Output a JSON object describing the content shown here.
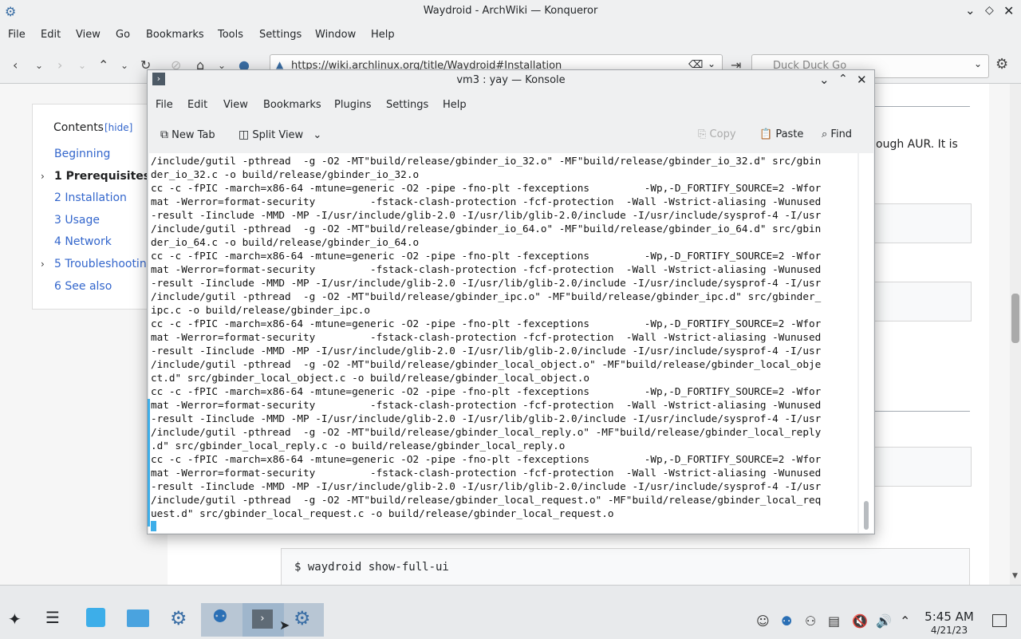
{
  "konqueror": {
    "title": "Waydroid - ArchWiki — Konqueror",
    "menu": [
      "File",
      "Edit",
      "View",
      "Go",
      "Bookmarks",
      "Tools",
      "Settings",
      "Window",
      "Help"
    ],
    "url": "https://wiki.archlinux.org/title/Waydroid#Installation",
    "search_placeholder": "Duck Duck Go"
  },
  "toc": {
    "title": "Contents",
    "hide": "[hide]",
    "items": [
      {
        "num": "",
        "label": "Beginning"
      },
      {
        "num": "1",
        "label": "Prerequisites"
      },
      {
        "num": "2",
        "label": "Installation"
      },
      {
        "num": "3",
        "label": "Usage"
      },
      {
        "num": "4",
        "label": "Network"
      },
      {
        "num": "5",
        "label": "Troubleshootin"
      },
      {
        "num": "6",
        "label": "See also"
      }
    ]
  },
  "wiki": {
    "text_fragment": "ough AUR. It is",
    "command": "$ waydroid show-full-ui"
  },
  "konsole": {
    "title": "vm3 : yay — Konsole",
    "menu": [
      "File",
      "Edit",
      "View",
      "Bookmarks",
      "Plugins",
      "Settings",
      "Help"
    ],
    "toolbar": {
      "new_tab": "New Tab",
      "split_view": "Split View",
      "copy": "Copy",
      "paste": "Paste",
      "find": "Find"
    },
    "lines": [
      "/include/gutil -pthread  -g -O2 -MT\"build/release/gbinder_io_32.o\" -MF\"build/release/gbinder_io_32.d\" src/gbin",
      "der_io_32.c -o build/release/gbinder_io_32.o",
      "cc -c -fPIC -march=x86-64 -mtune=generic -O2 -pipe -fno-plt -fexceptions         -Wp,-D_FORTIFY_SOURCE=2 -Wfor",
      "mat -Werror=format-security         -fstack-clash-protection -fcf-protection  -Wall -Wstrict-aliasing -Wunused",
      "-result -Iinclude -MMD -MP -I/usr/include/glib-2.0 -I/usr/lib/glib-2.0/include -I/usr/include/sysprof-4 -I/usr",
      "/include/gutil -pthread  -g -O2 -MT\"build/release/gbinder_io_64.o\" -MF\"build/release/gbinder_io_64.d\" src/gbin",
      "der_io_64.c -o build/release/gbinder_io_64.o",
      "cc -c -fPIC -march=x86-64 -mtune=generic -O2 -pipe -fno-plt -fexceptions         -Wp,-D_FORTIFY_SOURCE=2 -Wfor",
      "mat -Werror=format-security         -fstack-clash-protection -fcf-protection  -Wall -Wstrict-aliasing -Wunused",
      "-result -Iinclude -MMD -MP -I/usr/include/glib-2.0 -I/usr/lib/glib-2.0/include -I/usr/include/sysprof-4 -I/usr",
      "/include/gutil -pthread  -g -O2 -MT\"build/release/gbinder_ipc.o\" -MF\"build/release/gbinder_ipc.d\" src/gbinder_",
      "ipc.c -o build/release/gbinder_ipc.o",
      "cc -c -fPIC -march=x86-64 -mtune=generic -O2 -pipe -fno-plt -fexceptions         -Wp,-D_FORTIFY_SOURCE=2 -Wfor",
      "mat -Werror=format-security         -fstack-clash-protection -fcf-protection  -Wall -Wstrict-aliasing -Wunused",
      "-result -Iinclude -MMD -MP -I/usr/include/glib-2.0 -I/usr/lib/glib-2.0/include -I/usr/include/sysprof-4 -I/usr",
      "/include/gutil -pthread  -g -O2 -MT\"build/release/gbinder_local_object.o\" -MF\"build/release/gbinder_local_obje",
      "ct.d\" src/gbinder_local_object.c -o build/release/gbinder_local_object.o",
      "cc -c -fPIC -march=x86-64 -mtune=generic -O2 -pipe -fno-plt -fexceptions         -Wp,-D_FORTIFY_SOURCE=2 -Wfor",
      "mat -Werror=format-security         -fstack-clash-protection -fcf-protection  -Wall -Wstrict-aliasing -Wunused",
      "-result -Iinclude -MMD -MP -I/usr/include/glib-2.0 -I/usr/lib/glib-2.0/include -I/usr/include/sysprof-4 -I/usr",
      "/include/gutil -pthread  -g -O2 -MT\"build/release/gbinder_local_reply.o\" -MF\"build/release/gbinder_local_reply",
      ".d\" src/gbinder_local_reply.c -o build/release/gbinder_local_reply.o",
      "cc -c -fPIC -march=x86-64 -mtune=generic -O2 -pipe -fno-plt -fexceptions         -Wp,-D_FORTIFY_SOURCE=2 -Wfor",
      "mat -Werror=format-security         -fstack-clash-protection -fcf-protection  -Wall -Wstrict-aliasing -Wunused",
      "-result -Iinclude -MMD -MP -I/usr/include/glib-2.0 -I/usr/lib/glib-2.0/include -I/usr/include/sysprof-4 -I/usr",
      "/include/gutil -pthread  -g -O2 -MT\"build/release/gbinder_local_request.o\" -MF\"build/release/gbinder_local_req",
      "uest.d\" src/gbinder_local_request.c -o build/release/gbinder_local_request.o"
    ]
  },
  "taskbar": {
    "time": "5:45 AM",
    "date": "4/21/23"
  }
}
